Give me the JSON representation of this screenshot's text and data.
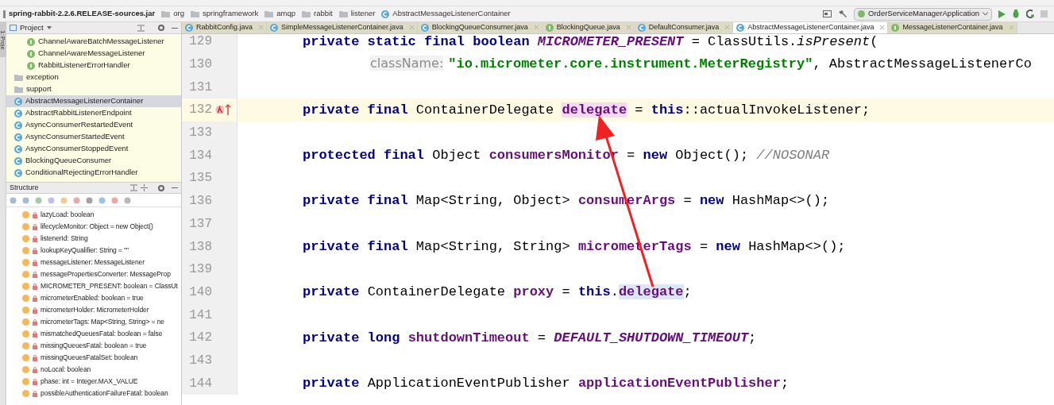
{
  "breadcrumbs": [
    "spring-rabbit-2.2.6.RELEASE-sources.jar",
    "org",
    "springframework",
    "amqp",
    "rabbit",
    "listener",
    "AbstractMessageListenerContainer"
  ],
  "run_config": "OrderServiceManagerApplication",
  "side_tab": "1: Proje",
  "project_panel": {
    "title": "Project",
    "nested_items": [
      {
        "kind": "interface",
        "label": "ChannelAwareBatchMessageListener",
        "selected": false
      },
      {
        "kind": "interface",
        "label": "ChannelAwareMessageListener",
        "selected": false
      },
      {
        "kind": "interface",
        "label": "RabbitListenerErrorHandler",
        "selected": false
      }
    ],
    "items": [
      {
        "kind": "package",
        "label": "exception",
        "selected": false
      },
      {
        "kind": "package",
        "label": "support",
        "selected": false
      },
      {
        "kind": "class",
        "label": "AbstractMessageListenerContainer",
        "selected": true
      },
      {
        "kind": "class",
        "label": "AbstractRabbitListenerEndpoint",
        "selected": false
      },
      {
        "kind": "class",
        "label": "AsyncConsumerRestartedEvent",
        "selected": false
      },
      {
        "kind": "class",
        "label": "AsyncConsumerStartedEvent",
        "selected": false
      },
      {
        "kind": "class",
        "label": "AsyncConsumerStoppedEvent",
        "selected": false
      },
      {
        "kind": "class",
        "label": "BlockingQueueConsumer",
        "selected": false
      },
      {
        "kind": "class",
        "label": "ConditionalRejectingErrorHandler",
        "selected": false
      }
    ]
  },
  "structure_panel": {
    "title": "Structure",
    "items": [
      "lazyLoad: boolean",
      "lifecycleMonitor: Object = new Object()",
      "listenerId: String",
      "lookupKeyQualifier: String = \"\"",
      "messageListener: MessageListener",
      "messagePropertiesConverter: MessageProp",
      "MICROMETER_PRESENT: boolean = ClassUt",
      "micrometerEnabled: boolean = true",
      "micrometerHolder: MicrometerHolder",
      "micrometerTags: Map<String, String> = ne",
      "mismatchedQueuesFatal: boolean = false",
      "missingQueuesFatal: boolean = true",
      "missingQueuesFatalSet: boolean",
      "noLocal: boolean",
      "phase: int = Integer.MAX_VALUE",
      "possibleAuthenticationFailureFatal: boolean"
    ]
  },
  "tabs": [
    {
      "kind": "class",
      "label": "RabbitConfig.java",
      "selected": false
    },
    {
      "kind": "class",
      "label": "SimpleMessageListenerContainer.java",
      "selected": false
    },
    {
      "kind": "class",
      "label": "BlockingQueueConsumer.java",
      "selected": false
    },
    {
      "kind": "interface",
      "label": "BlockingQueue.java",
      "selected": false
    },
    {
      "kind": "class",
      "label": "DefaultConsumer.java",
      "selected": false
    },
    {
      "kind": "class",
      "label": "AbstractMessageListenerContainer.java",
      "selected": true
    },
    {
      "kind": "interface",
      "label": "MessageListenerContainer.java",
      "selected": false
    }
  ],
  "code_lines": [
    {
      "number": "129",
      "current": false,
      "tokens": [
        {
          "kind": "keyword",
          "text": "private static final boolean "
        },
        {
          "kind": "static",
          "text": "MICROMETER_PRESENT"
        },
        {
          "kind": "plain",
          "text": " = ClassUtils."
        },
        {
          "kind": "call_italic",
          "text": "isPresent"
        },
        {
          "kind": "plain",
          "text": "("
        }
      ]
    },
    {
      "number": "130",
      "current": false,
      "indent": true,
      "tokens": [
        {
          "kind": "hint",
          "text": "className:"
        },
        {
          "kind": "string",
          "text": "\"io.micrometer.core.instrument.MeterRegistry\""
        },
        {
          "kind": "plain",
          "text": ", AbstractMessageListenerCo"
        }
      ]
    },
    {
      "number": "131",
      "current": false
    },
    {
      "number": "132",
      "current": true,
      "tokens": [
        {
          "kind": "keyword",
          "text": "private final "
        },
        {
          "kind": "plain",
          "text": "ContainerDelegate "
        },
        {
          "kind": "write_usage",
          "text": "delegate"
        },
        {
          "kind": "plain",
          "text": " = "
        },
        {
          "kind": "keyword",
          "text": "this"
        },
        {
          "kind": "plain",
          "text": "::actualInvokeListener;"
        }
      ]
    },
    {
      "number": "133",
      "current": false
    },
    {
      "number": "134",
      "current": false,
      "tokens": [
        {
          "kind": "keyword",
          "text": "protected final "
        },
        {
          "kind": "plain",
          "text": "Object "
        },
        {
          "kind": "field",
          "text": "consumersMonitor"
        },
        {
          "kind": "plain",
          "text": " = "
        },
        {
          "kind": "keyword",
          "text": "new "
        },
        {
          "kind": "plain",
          "text": "Object(); "
        },
        {
          "kind": "comment",
          "text": "//NOSONAR"
        }
      ]
    },
    {
      "number": "135",
      "current": false
    },
    {
      "number": "136",
      "current": false,
      "tokens": [
        {
          "kind": "keyword",
          "text": "private final "
        },
        {
          "kind": "plain",
          "text": "Map<String, Object> "
        },
        {
          "kind": "field",
          "text": "consumerArgs"
        },
        {
          "kind": "plain",
          "text": " = "
        },
        {
          "kind": "keyword",
          "text": "new "
        },
        {
          "kind": "plain",
          "text": "HashMap<>();"
        }
      ]
    },
    {
      "number": "137",
      "current": false
    },
    {
      "number": "138",
      "current": false,
      "tokens": [
        {
          "kind": "keyword",
          "text": "private final "
        },
        {
          "kind": "plain",
          "text": "Map<String, String> "
        },
        {
          "kind": "field",
          "text": "micrometerTags"
        },
        {
          "kind": "plain",
          "text": " = "
        },
        {
          "kind": "keyword",
          "text": "new "
        },
        {
          "kind": "plain",
          "text": "HashMap<>();"
        }
      ]
    },
    {
      "number": "139",
      "current": false
    },
    {
      "number": "140",
      "current": false,
      "tokens": [
        {
          "kind": "keyword",
          "text": "private "
        },
        {
          "kind": "plain",
          "text": "ContainerDelegate "
        },
        {
          "kind": "field",
          "text": "proxy"
        },
        {
          "kind": "plain",
          "text": " = "
        },
        {
          "kind": "keyword",
          "text": "this"
        },
        {
          "kind": "plain",
          "text": "."
        },
        {
          "kind": "read_usage",
          "text": "delegate"
        },
        {
          "kind": "plain",
          "text": ";"
        }
      ]
    },
    {
      "number": "141",
      "current": false
    },
    {
      "number": "142",
      "current": false,
      "tokens": [
        {
          "kind": "keyword",
          "text": "private long "
        },
        {
          "kind": "field",
          "text": "shutdownTimeout"
        },
        {
          "kind": "plain",
          "text": " = "
        },
        {
          "kind": "static",
          "text": "DEFAULT_SHUTDOWN_TIMEOUT"
        },
        {
          "kind": "plain",
          "text": ";"
        }
      ]
    },
    {
      "number": "143",
      "current": false
    },
    {
      "number": "144",
      "current": false,
      "tokens": [
        {
          "kind": "keyword",
          "text": "private "
        },
        {
          "kind": "plain",
          "text": "ApplicationEventPublisher "
        },
        {
          "kind": "field",
          "text": "applicationEventPublisher"
        },
        {
          "kind": "plain",
          "text": ";"
        }
      ]
    }
  ]
}
